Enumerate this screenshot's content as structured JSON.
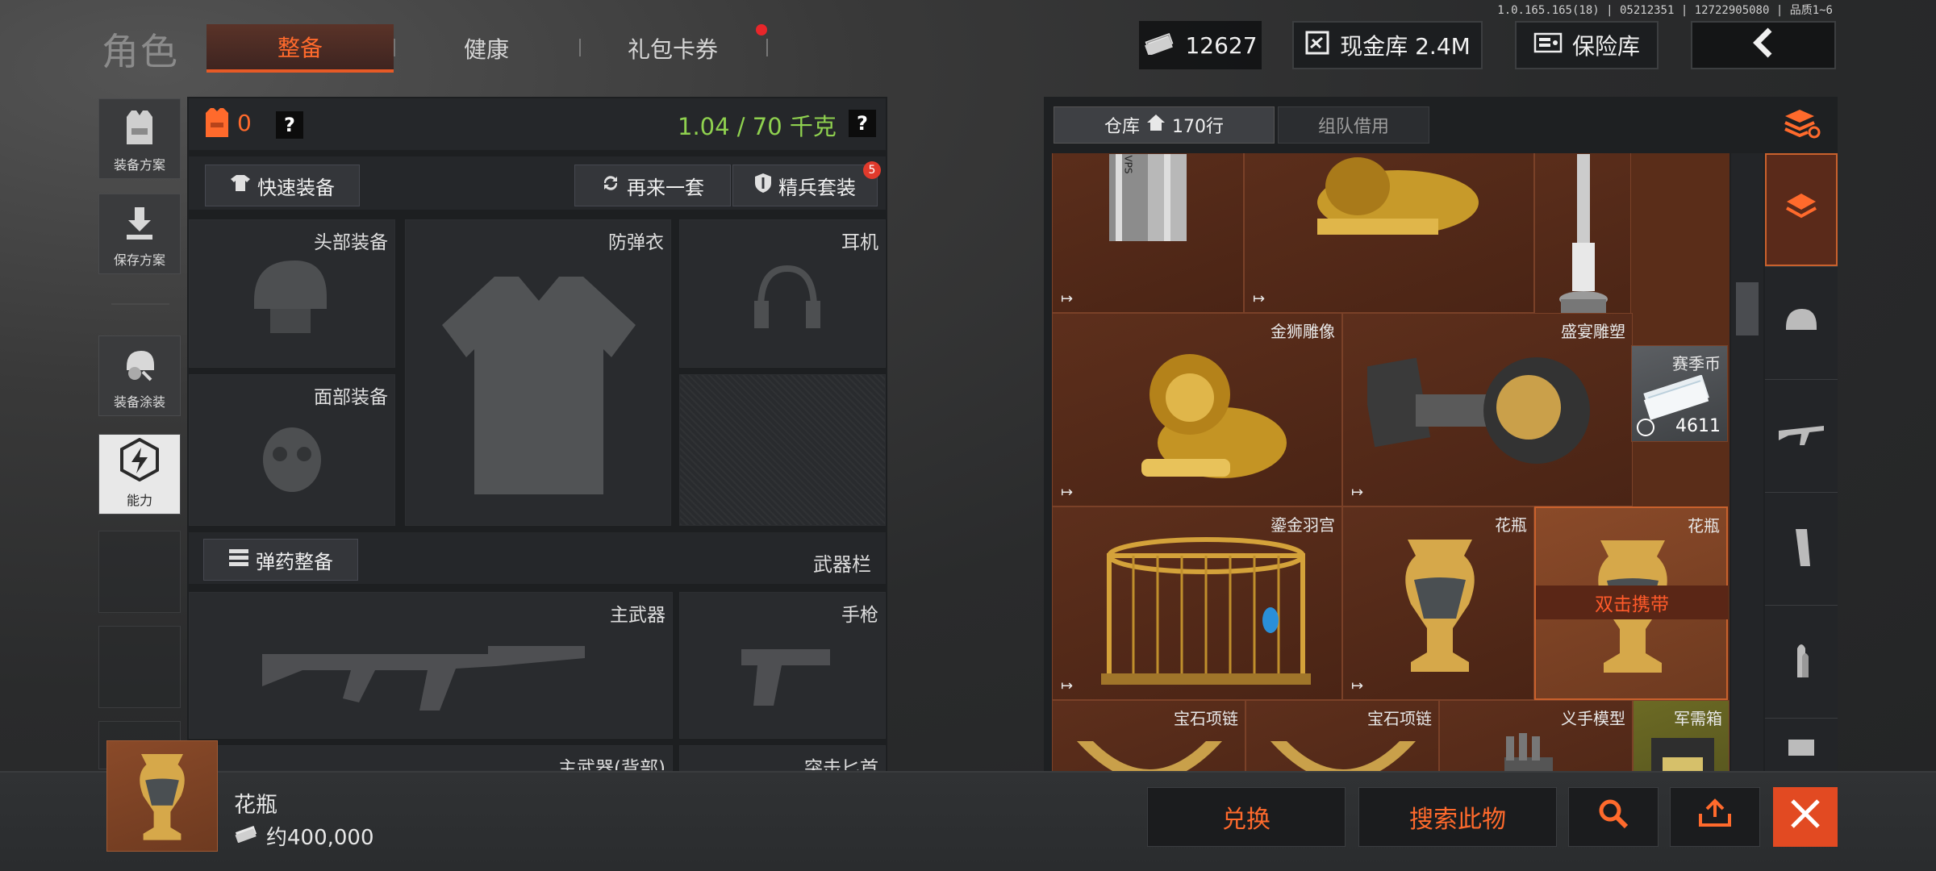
{
  "version": "1.0.165.165(18) | 05212351 | 12722905080 | 品质1~6",
  "header": {
    "title": "角色",
    "tabs": [
      {
        "label": "整备",
        "active": true
      },
      {
        "label": "健康",
        "active": false
      },
      {
        "label": "礼包卡券",
        "active": false,
        "notification_dot": true
      }
    ],
    "cash": "12627",
    "vault": "现金库 2.4M",
    "insurance": "保险库",
    "icons": {
      "cash": "banknote-icon",
      "vault": "vault-icon",
      "insurance": "safe-icon",
      "back": "back-arrow-icon"
    }
  },
  "sidebar": {
    "items": [
      {
        "label": "装备方案",
        "icon": "vest-icon"
      },
      {
        "label": "保存方案",
        "icon": "download-icon"
      },
      {
        "label": "装备涂装",
        "icon": "helmet-paint-icon"
      },
      {
        "label": "能力",
        "icon": "ability-icon",
        "active": true
      }
    ]
  },
  "loadout": {
    "armor_count": "0",
    "help": "?",
    "weight": "1.04 / 70 千克",
    "quick_equip": "快速装备",
    "again": "再来一套",
    "elite_kit": "精兵套装",
    "elite_badge": "5",
    "slots": {
      "head": "头部装备",
      "vest": "防弹衣",
      "headset": "耳机",
      "face": "面部装备",
      "primary": "主武器",
      "pistol": "手枪",
      "primary_back": "主武器(背部)",
      "dagger": "突击匕首"
    },
    "ammo": "弹药整备",
    "weapon_bar": "武器栏"
  },
  "warehouse": {
    "tab_label": "仓库",
    "tab_count": "170行",
    "team_tab": "组队借用",
    "crate_text": "VPS",
    "items": [
      {
        "name": "金狮雕像"
      },
      {
        "name": "盛宴雕塑"
      },
      {
        "name": "赛季币",
        "count": "4611"
      },
      {
        "name": "鎏金羽宫"
      },
      {
        "name": "花瓶"
      },
      {
        "name": "花瓶",
        "selected": true,
        "hint": "双击携带"
      },
      {
        "name": "宝石项链"
      },
      {
        "name": "宝石项链"
      },
      {
        "name": "义手模型"
      },
      {
        "name": "军需箱"
      }
    ],
    "categories": [
      "sort-icon",
      "all-items-icon",
      "helmet-icon",
      "rifle-icon",
      "magazine-icon",
      "ammo-icon",
      "medkit-icon"
    ]
  },
  "selected_item": {
    "name": "花瓶",
    "price": "约400,000"
  },
  "actions": {
    "exchange": "兑换",
    "search": "搜索此物"
  },
  "colors": {
    "accent": "#ff6a2c",
    "weight_ok": "#8fd14f",
    "item_bg": "#5a2d19",
    "badge": "#e03a2c"
  }
}
